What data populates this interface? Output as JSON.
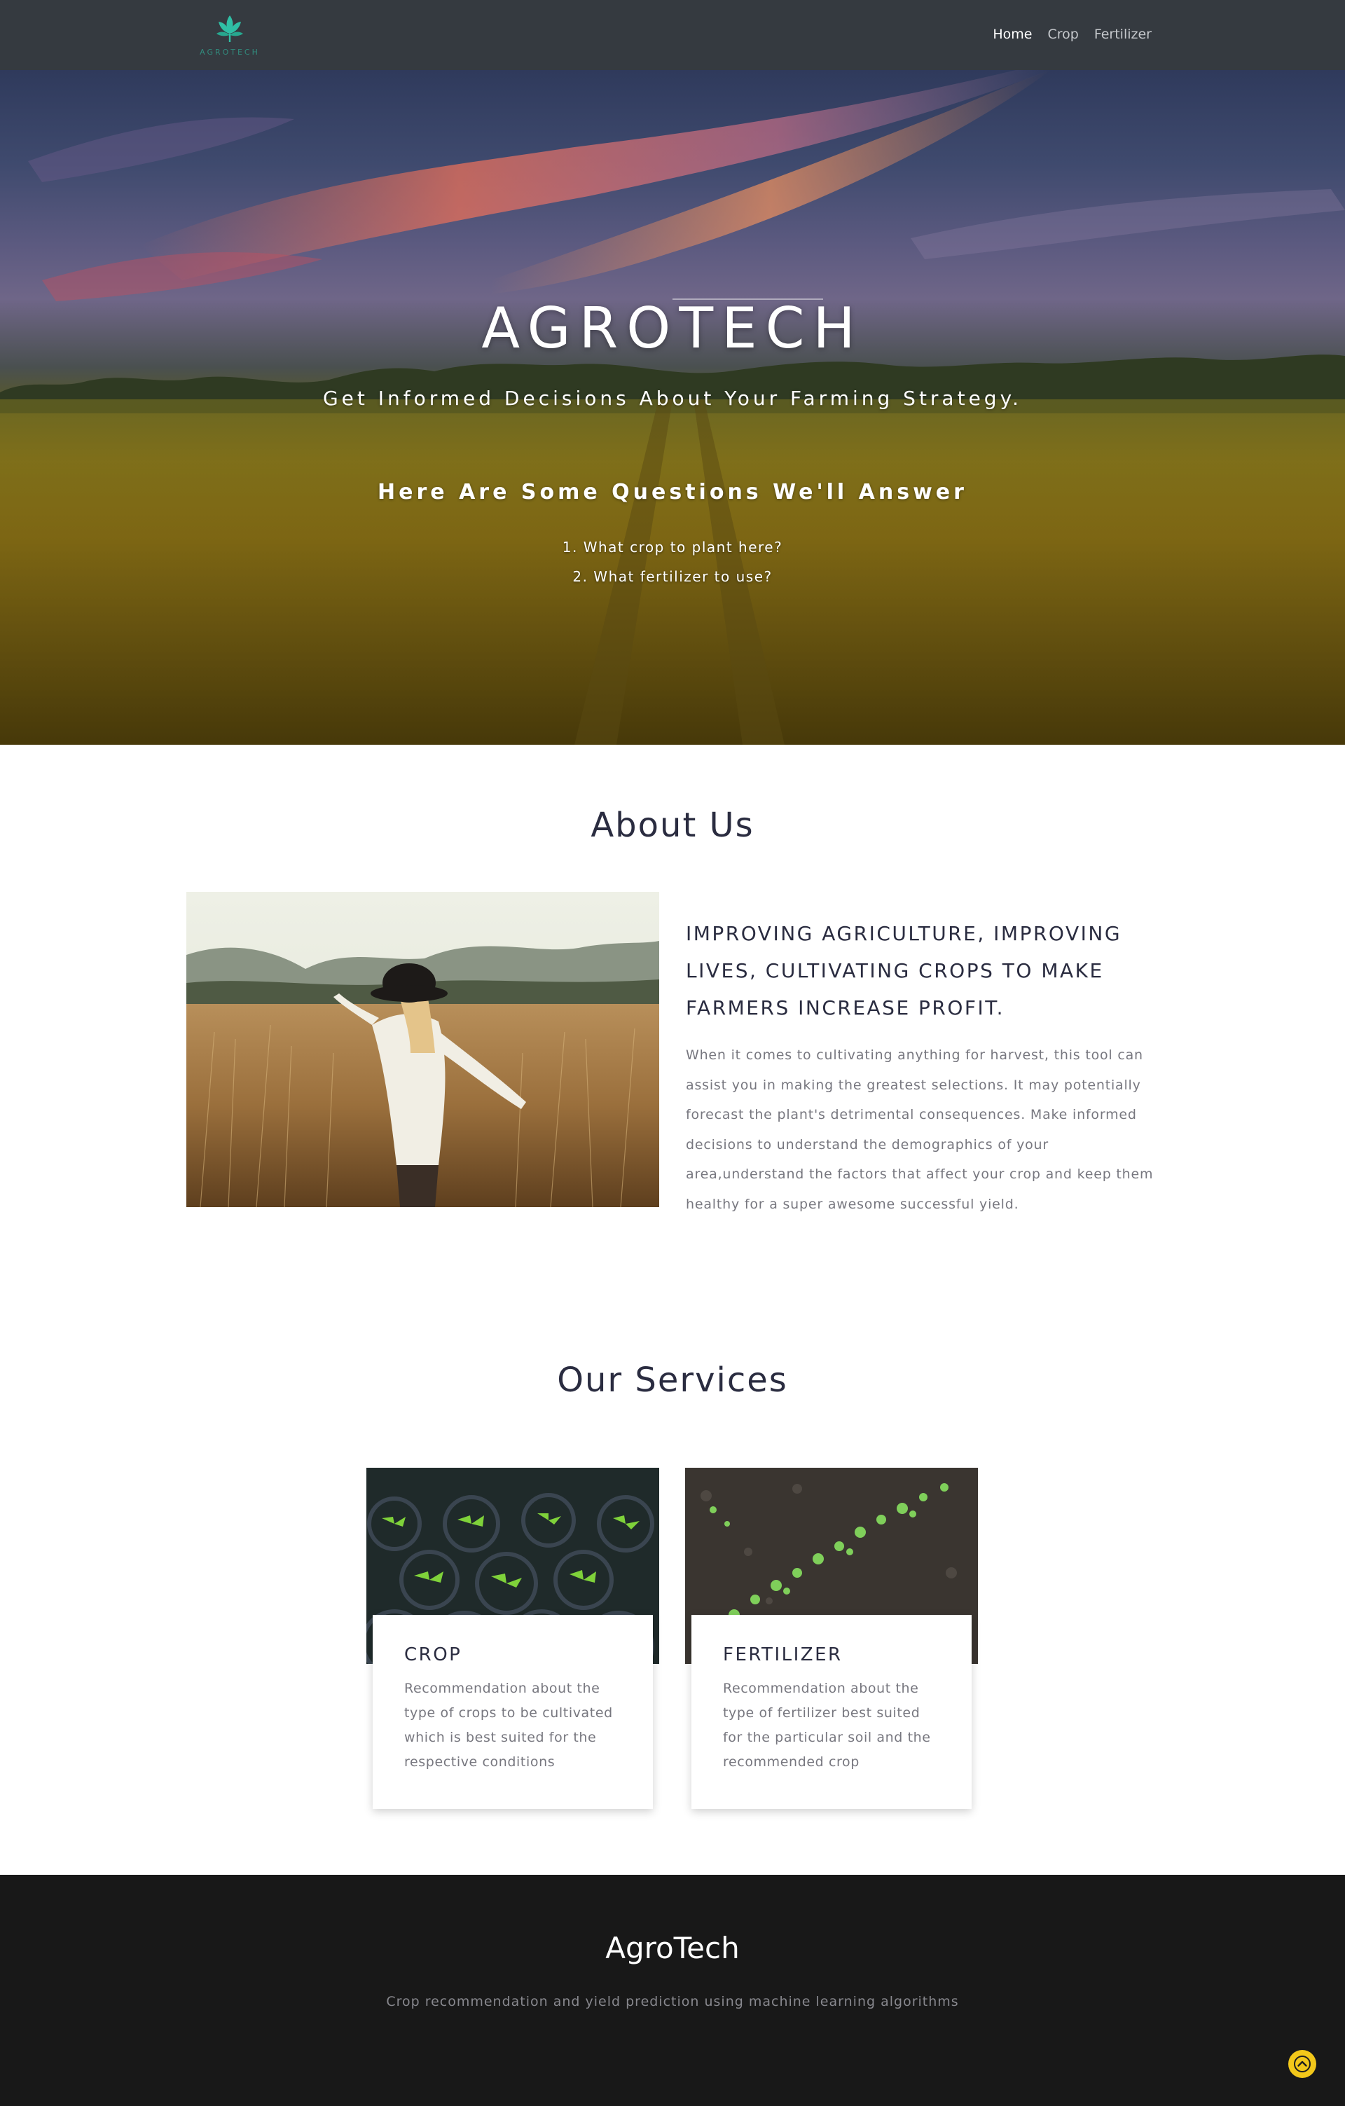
{
  "colors": {
    "navbar_bg": "#353a40",
    "logo_accent": "#2fbfa5",
    "heading_text": "#2a2c40",
    "body_text": "#77777f",
    "footer_bg": "#181818",
    "back_to_top": "#f2c71a"
  },
  "nav": {
    "logo_icon": "leaf-logo-icon",
    "logo_text": "AGROTECH",
    "links": [
      {
        "label": "Home",
        "active": true
      },
      {
        "label": "Crop",
        "active": false
      },
      {
        "label": "Fertilizer",
        "active": false
      }
    ]
  },
  "hero": {
    "title": "AGROTECH",
    "subtitle": "Get Informed Decisions About Your Farming Strategy.",
    "questions_heading": "Here Are Some Questions We'll Answer",
    "questions": [
      "1. What crop to plant here?",
      "2. What fertilizer to use?"
    ]
  },
  "about": {
    "heading": "About Us",
    "tagline": "IMPROVING AGRICULTURE, IMPROVING LIVES, CULTIVATING CROPS TO MAKE FARMERS INCREASE PROFIT.",
    "body": "When it comes to cultivating anything for harvest, this tool can assist you in making the greatest selections. It may potentially forecast the plant's detrimental consequences. Make informed decisions to understand the demographics of your area,understand the factors that affect your crop and keep them healthy for a super awesome successful yield."
  },
  "services": {
    "heading": "Our Services",
    "items": [
      {
        "title": "CROP",
        "description": "Recommendation about the type of crops to be cultivated which is best suited for the respective conditions"
      },
      {
        "title": "FERTILIZER",
        "description": "Recommendation about the type of fertilizer best suited for the particular soil and the recommended crop"
      }
    ]
  },
  "footer": {
    "brand": "AgroTech",
    "tagline": "Crop recommendation and yield prediction using machine learning algorithms",
    "back_to_top_icon": "chevron-up-icon"
  }
}
